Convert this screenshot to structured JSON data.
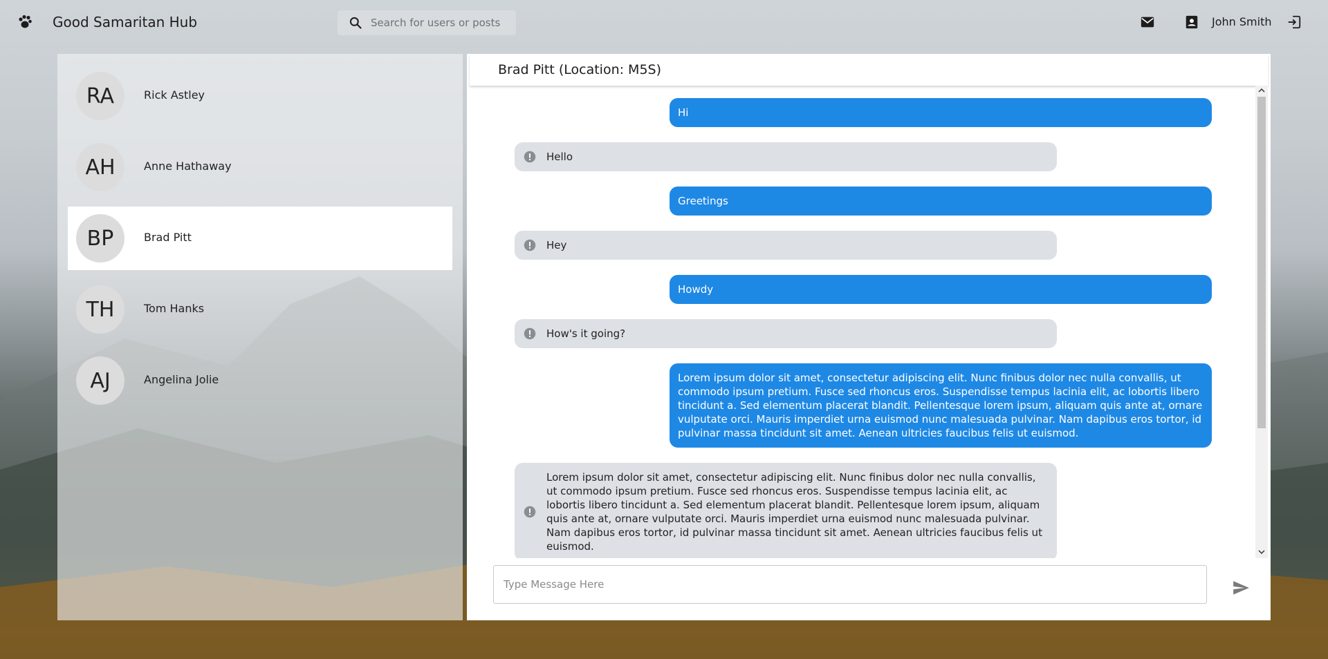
{
  "app": {
    "title": "Good Samaritan Hub"
  },
  "search": {
    "placeholder": "Search for users or posts"
  },
  "user": {
    "name": "John Smith"
  },
  "icons": {
    "logo": "paw-icon",
    "search": "search-icon",
    "mail": "mail-icon",
    "contact": "contact-card-icon",
    "logout": "logout-icon",
    "alert": "alert-circle-icon",
    "send": "send-icon"
  },
  "contacts": [
    {
      "initials": "RA",
      "name": "Rick Astley",
      "active": false
    },
    {
      "initials": "AH",
      "name": "Anne Hathaway",
      "active": false
    },
    {
      "initials": "BP",
      "name": "Brad Pitt",
      "active": true
    },
    {
      "initials": "TH",
      "name": "Tom Hanks",
      "active": false
    },
    {
      "initials": "AJ",
      "name": "Angelina Jolie",
      "active": false
    }
  ],
  "chat": {
    "header": "Brad Pitt (Location: M5S)",
    "messages": [
      {
        "direction": "out",
        "text": "Hi"
      },
      {
        "direction": "in",
        "text": "Hello"
      },
      {
        "direction": "out",
        "text": "Greetings"
      },
      {
        "direction": "in",
        "text": "Hey"
      },
      {
        "direction": "out",
        "text": "Howdy"
      },
      {
        "direction": "in",
        "text": "How's it going?"
      },
      {
        "direction": "out",
        "text": "Lorem ipsum dolor sit amet, consectetur adipiscing elit. Nunc finibus dolor nec nulla convallis, ut commodo ipsum pretium. Fusce sed rhoncus eros. Suspendisse tempus lacinia elit, ac lobortis libero tincidunt a. Sed elementum placerat blandit. Pellentesque lorem ipsum, aliquam quis ante at, ornare vulputate orci. Mauris imperdiet urna euismod nunc malesuada pulvinar. Nam dapibus eros tortor, id pulvinar massa tincidunt sit amet. Aenean ultricies faucibus felis ut euismod."
      },
      {
        "direction": "in",
        "text": "Lorem ipsum dolor sit amet, consectetur adipiscing elit. Nunc finibus dolor nec nulla convallis, ut commodo ipsum pretium. Fusce sed rhoncus eros. Suspendisse tempus lacinia elit, ac lobortis libero tincidunt a. Sed elementum placerat blandit. Pellentesque lorem ipsum, aliquam quis ante at, ornare vulputate orci. Mauris imperdiet urna euismod nunc malesuada pulvinar. Nam dapibus eros tortor, id pulvinar massa tincidunt sit amet. Aenean ultricies faucibus felis ut euismod."
      }
    ],
    "compose_placeholder": "Type Message Here"
  },
  "colors": {
    "outgoing_bubble": "#1e88e5",
    "incoming_bubble": "#dde0e5",
    "active_contact": "#ffffff"
  }
}
